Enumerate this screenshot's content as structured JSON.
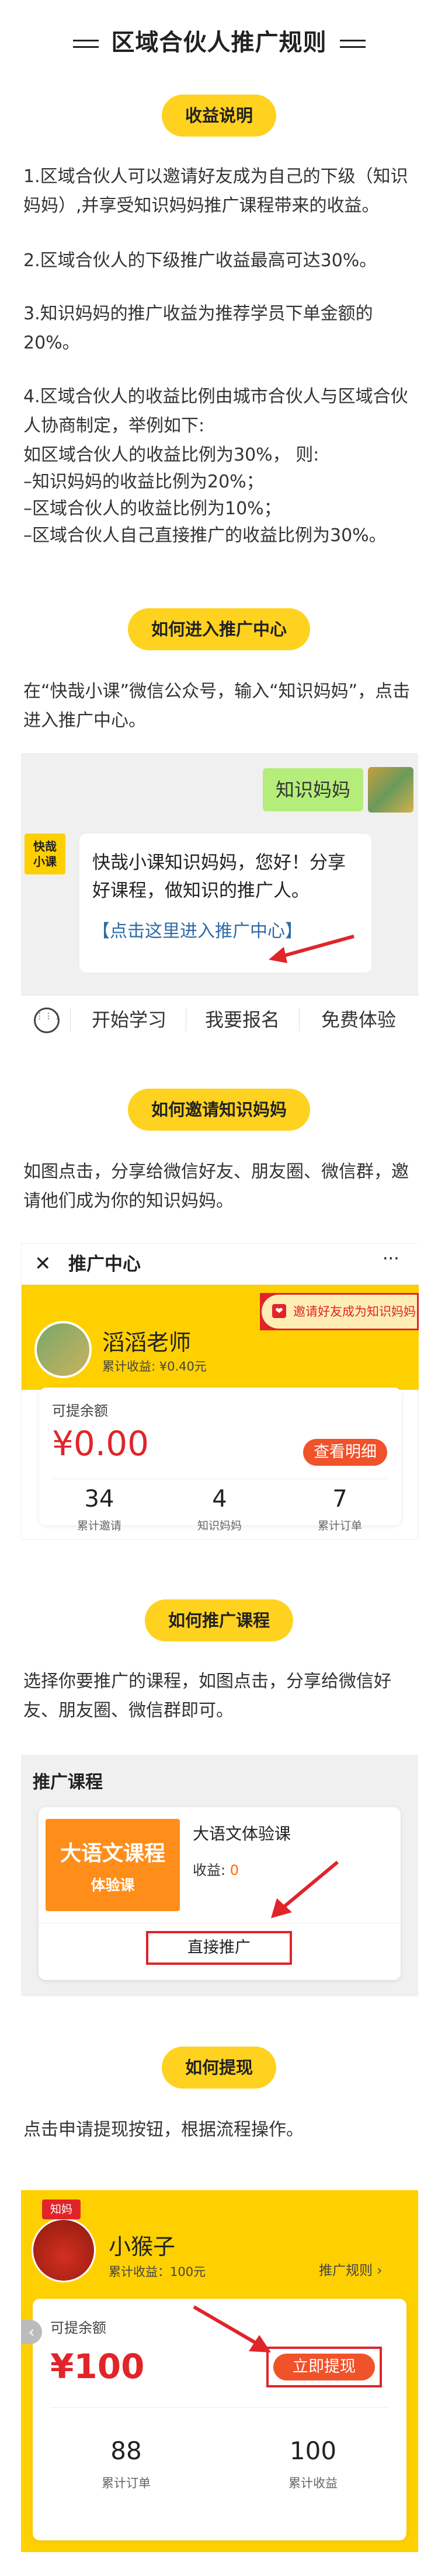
{
  "title": "区域合伙人推广规则",
  "sections": {
    "earnings": {
      "pill": "收益说明",
      "p1": "1.区域合伙人可以邀请好友成为自己的下级（知识妈妈）,并享受知识妈妈推广课程带来的收益。",
      "p2": "2.区域合伙人的下级推广收益最高可达30%。",
      "p3": "3.知识妈妈的推广收益为推荐学员下单金额的20%。",
      "p4": "4.区域合伙人的收益比例由城市合伙人与区域合伙人协商制定，举例如下:",
      "p4_lines": [
        "如区域合伙人的收益比例为30%， 则:",
        "–知识妈妈的收益比例为20%；",
        "–区域合伙人的收益比例为10%；",
        "–区域合伙人自己直接推广的收益比例为30%。"
      ]
    },
    "enter": {
      "pill": "如何进入推广中心",
      "para": "在“快哉小课”微信公众号，输入“知识妈妈”，点击进入推广中心。",
      "chat_user_msg": "知识妈妈",
      "bot_avatar": "快哉\n小课",
      "bot_msg": "快哉小课知识妈妈，您好！分享好课程，做知识的推广人。",
      "bot_link": "【点击这里进入推广中心】",
      "menu": [
        "开始学习",
        "我要报名",
        "免费体验"
      ]
    },
    "invite": {
      "pill": "如何邀请知识妈妈",
      "para": "如图点击，分享给微信好友、朋友圈、微信群，邀请他们成为你的知识妈妈。",
      "nav_title": "推广中心",
      "user_name": "滔滔老师",
      "earnings_label": "累计收益: ¥0.40元",
      "invite_btn": "邀请好友成为知识妈妈",
      "balance_label": "可提余额",
      "balance": "¥0.00",
      "detail_btn": "查看明细",
      "stats": [
        {
          "num": "34",
          "label": "累计邀请"
        },
        {
          "num": "4",
          "label": "知识妈妈"
        },
        {
          "num": "7",
          "label": "累计订单"
        }
      ]
    },
    "promote": {
      "pill": "如何推广课程",
      "para": "选择你要推广的课程，如图点击，分享给微信好友、朋友圈、微信群即可。",
      "header": "推广课程",
      "cover_line1": "大语文课程",
      "cover_line2": "体验课",
      "course_name": "大语文体验课",
      "income_label": "收益:",
      "income_value": "0",
      "promote_btn": "直接推广"
    },
    "withdraw": {
      "pill": "如何提现",
      "para": "点击申请提现按钮，根据流程操作。",
      "badge": "知妈",
      "user_name": "小猴子",
      "earnings_label": "累计收益：100元",
      "rules_link": "推广规则 ›",
      "balance_label": "可提余额",
      "balance": "¥100",
      "withdraw_btn": "立即提现",
      "stats": [
        {
          "num": "88",
          "label": "累计订单"
        },
        {
          "num": "100",
          "label": "累计收益"
        }
      ]
    }
  },
  "colors": {
    "accent": "#ffd21f",
    "red": "#e1242a",
    "orange": "#ff6a00",
    "link": "#2d6ba8"
  }
}
